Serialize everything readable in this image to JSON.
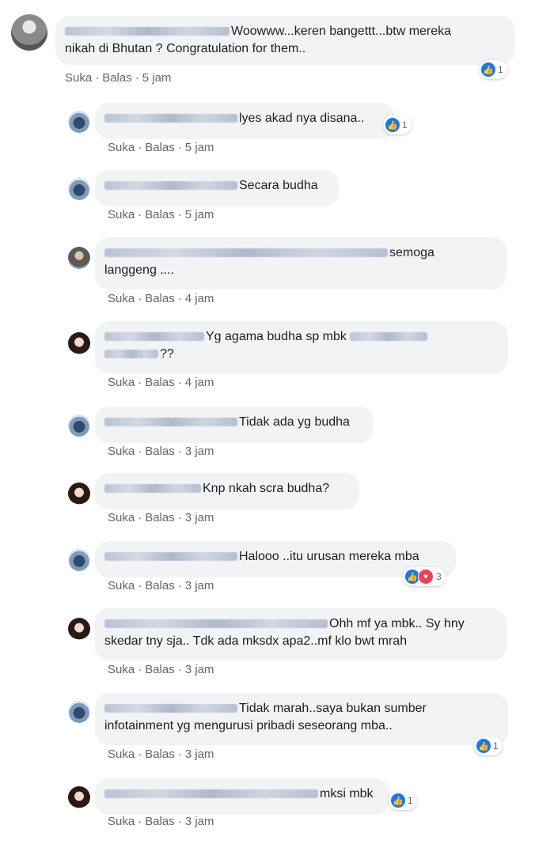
{
  "actions": {
    "like": "Suka",
    "reply": "Balas"
  },
  "comments": [
    {
      "line1": "Woowww...keren bangettt...btw mereka",
      "line2": "nikah di Bhutan ? Congratulation for them..",
      "time": "5 jam",
      "reaction_count": "1"
    },
    {
      "line1": "lyes akad nya disana..",
      "time": "5 jam",
      "reaction_count": "1"
    },
    {
      "line1": "Secara budha",
      "time": "5 jam"
    },
    {
      "line1": "semoga",
      "line2": "langgeng ....",
      "time": "4 jam"
    },
    {
      "line1": "Yg agama budha sp mbk",
      "line2": "??",
      "time": "4 jam"
    },
    {
      "line1": "Tidak ada yg budha",
      "time": "3 jam"
    },
    {
      "line1": "Knp nkah scra budha?",
      "time": "3 jam"
    },
    {
      "line1": "Halooo ..itu urusan mereka mba",
      "time": "3 jam",
      "reaction_count": "3"
    },
    {
      "line1": "Ohh mf ya mbk.. Sy hny",
      "line2": "skedar tny sja.. Tdk ada mksdx apa2..mf klo bwt mrah",
      "time": "3 jam"
    },
    {
      "line1": "Tidak marah..saya bukan sumber",
      "line2": "infotainment yg mengurusi pribadi seseorang mba..",
      "time": "3 jam",
      "reaction_count": "1"
    },
    {
      "line1": "mksi mbk",
      "time": "3 jam",
      "reaction_count": "1"
    }
  ],
  "icons": {
    "like": "like-thumb-icon",
    "love": "love-heart-icon"
  },
  "colors": {
    "bubble": "#f2f3f5",
    "like": "#1877f2",
    "love": "#f33e58",
    "meta": "#606770"
  }
}
